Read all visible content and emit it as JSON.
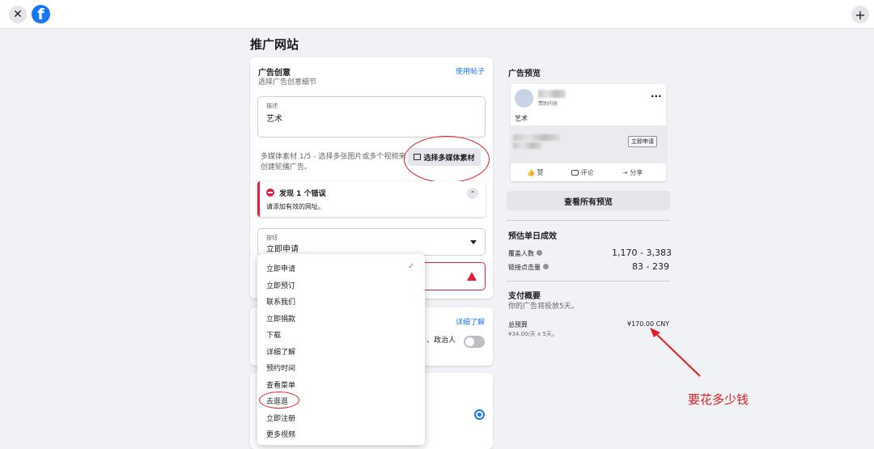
{
  "topbar": {
    "close_icon": "✕",
    "logo": "f",
    "add_icon": "+"
  },
  "page_title": "推广网站",
  "creative": {
    "title": "广告创意",
    "subtitle": "选择广告创意细节",
    "use_post": "使用帖子",
    "description_label": "描述",
    "description_value": "艺术",
    "media_text_1": "多媒体素材 1/5 - 选择多张图片或多个视频来",
    "media_text_2": "创建轮播广告。",
    "media_button": "选择多媒体素材"
  },
  "error": {
    "title": "发现 1 个错误",
    "body": "请添加有效的网址。"
  },
  "button_field": {
    "label": "按钮",
    "value": "立即申请"
  },
  "dropdown": {
    "items": [
      "立即申请",
      "立即预订",
      "联系我们",
      "立即捐款",
      "下载",
      "详细了解",
      "预约时间",
      "查看菜单",
      "去逛逛",
      "立即注册",
      "更多视频"
    ],
    "selected": "立即申请",
    "highlighted": "去逛逛"
  },
  "special_category": {
    "learn_more": "详细了解",
    "politician_text": "、政治人"
  },
  "preview": {
    "title": "广告预览",
    "sponsored": "赞助内容",
    "post_text": "艺术",
    "apply_button": "立即申请",
    "like": "赞",
    "comment": "评论",
    "share": "分享",
    "view_all": "查看所有预览"
  },
  "estimate": {
    "title": "预估单日成效",
    "reach_label": "覆盖人数",
    "reach_value": "1,170 - 3,383",
    "clicks_label": "链接点击量",
    "clicks_value": "83 - 239"
  },
  "payment": {
    "title": "支付概要",
    "subtitle": "你的广告将投放5天。",
    "budget_label": "总预算",
    "budget_detail": "¥34.00/天 x 5天。",
    "budget_value": "¥170.00 CNY"
  },
  "annotation": {
    "text": "要花多少钱",
    "color": "#e02020"
  }
}
